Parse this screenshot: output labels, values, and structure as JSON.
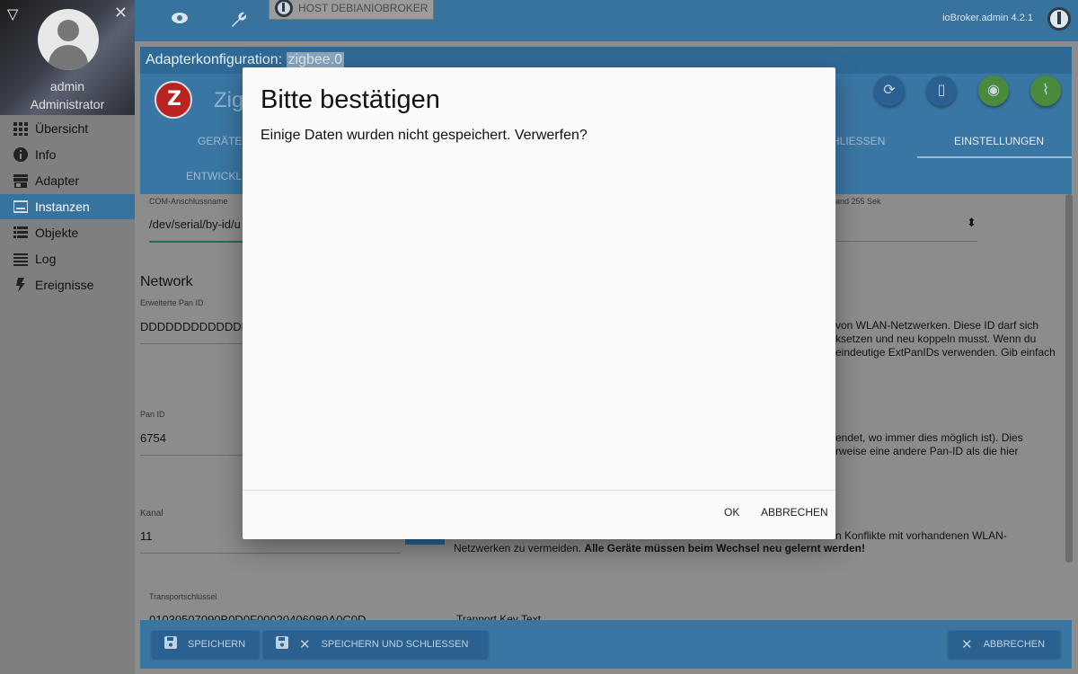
{
  "sidebar": {
    "user_name": "admin",
    "user_role": "Administrator",
    "items": [
      {
        "label": "Übersicht",
        "icon": "grid-icon"
      },
      {
        "label": "Info",
        "icon": "info-icon"
      },
      {
        "label": "Adapter",
        "icon": "store-icon"
      },
      {
        "label": "Instanzen",
        "icon": "instances-icon"
      },
      {
        "label": "Objekte",
        "icon": "list-icon"
      },
      {
        "label": "Log",
        "icon": "log-icon"
      },
      {
        "label": "Ereignisse",
        "icon": "bolt-icon"
      }
    ],
    "active_item": "Instanzen"
  },
  "topbar": {
    "host_label": "HOST DEBIANIOBROKER",
    "version": "ioBroker.admin 4.2.1",
    "icons": [
      "eye-icon",
      "wrench-icon",
      "power-icon"
    ]
  },
  "config": {
    "title_prefix": "Adapterkonfiguration: ",
    "instance": "zigbee.0",
    "adapter_title_partial": "Zig",
    "tabs": [
      "GERÄTE",
      "ENTWICKLE",
      "HLIESSEN",
      "EINSTELLUNGEN"
    ],
    "selected_tab": "EINSTELLUNGEN",
    "action_icons": [
      "refresh-icon",
      "device-icon",
      "wifi-icon",
      "signal-off-icon"
    ]
  },
  "form": {
    "com_port_label": "COM-Anschlussname",
    "com_port_value": "/dev/serial/by-id/u",
    "right_label_partial": "and 255 Sek",
    "network_heading": "Network",
    "ext_pan_label": "Erweiterte Pan ID",
    "ext_pan_value": "DDDDDDDDDDDDD",
    "ext_pan_desc": [
      "von WLAN-Netzwerken. Diese ID darf sich",
      "ksetzen und neu koppeln musst. Wenn du",
      "eindeutige ExtPanIDs verwenden. Gib einfach"
    ],
    "pan_label": "Pan ID",
    "pan_value": "6754",
    "pan_desc": [
      "endet, wo immer dies möglich ist). Dies",
      "rweise eine andere Pan-ID als die hier"
    ],
    "channel_label": "Kanal",
    "channel_value": "11",
    "channel_desc_1": "n Konflikte mit vorhandenen WLAN-",
    "channel_desc_2_normal": "Netzwerken zu vermeiden. ",
    "channel_desc_2_bold": "Alle Geräte müssen beim Wechsel neu gelernt werden!",
    "transport_label": "Transportschlüssel",
    "transport_value": "01030507090B0D0F00020406080A0C0D",
    "transport_desc": "Tranport Key Text"
  },
  "bottombar": {
    "save_label": "SPEICHERN",
    "save_close_label": "SPEICHERN UND SCHLIESSEN",
    "cancel_label": "ABBRECHEN"
  },
  "dialog": {
    "title": "Bitte bestätigen",
    "message": "Einige Daten wurden nicht gespeichert. Verwerfen?",
    "ok_label": "OK",
    "cancel_label": "ABBRECHEN"
  }
}
